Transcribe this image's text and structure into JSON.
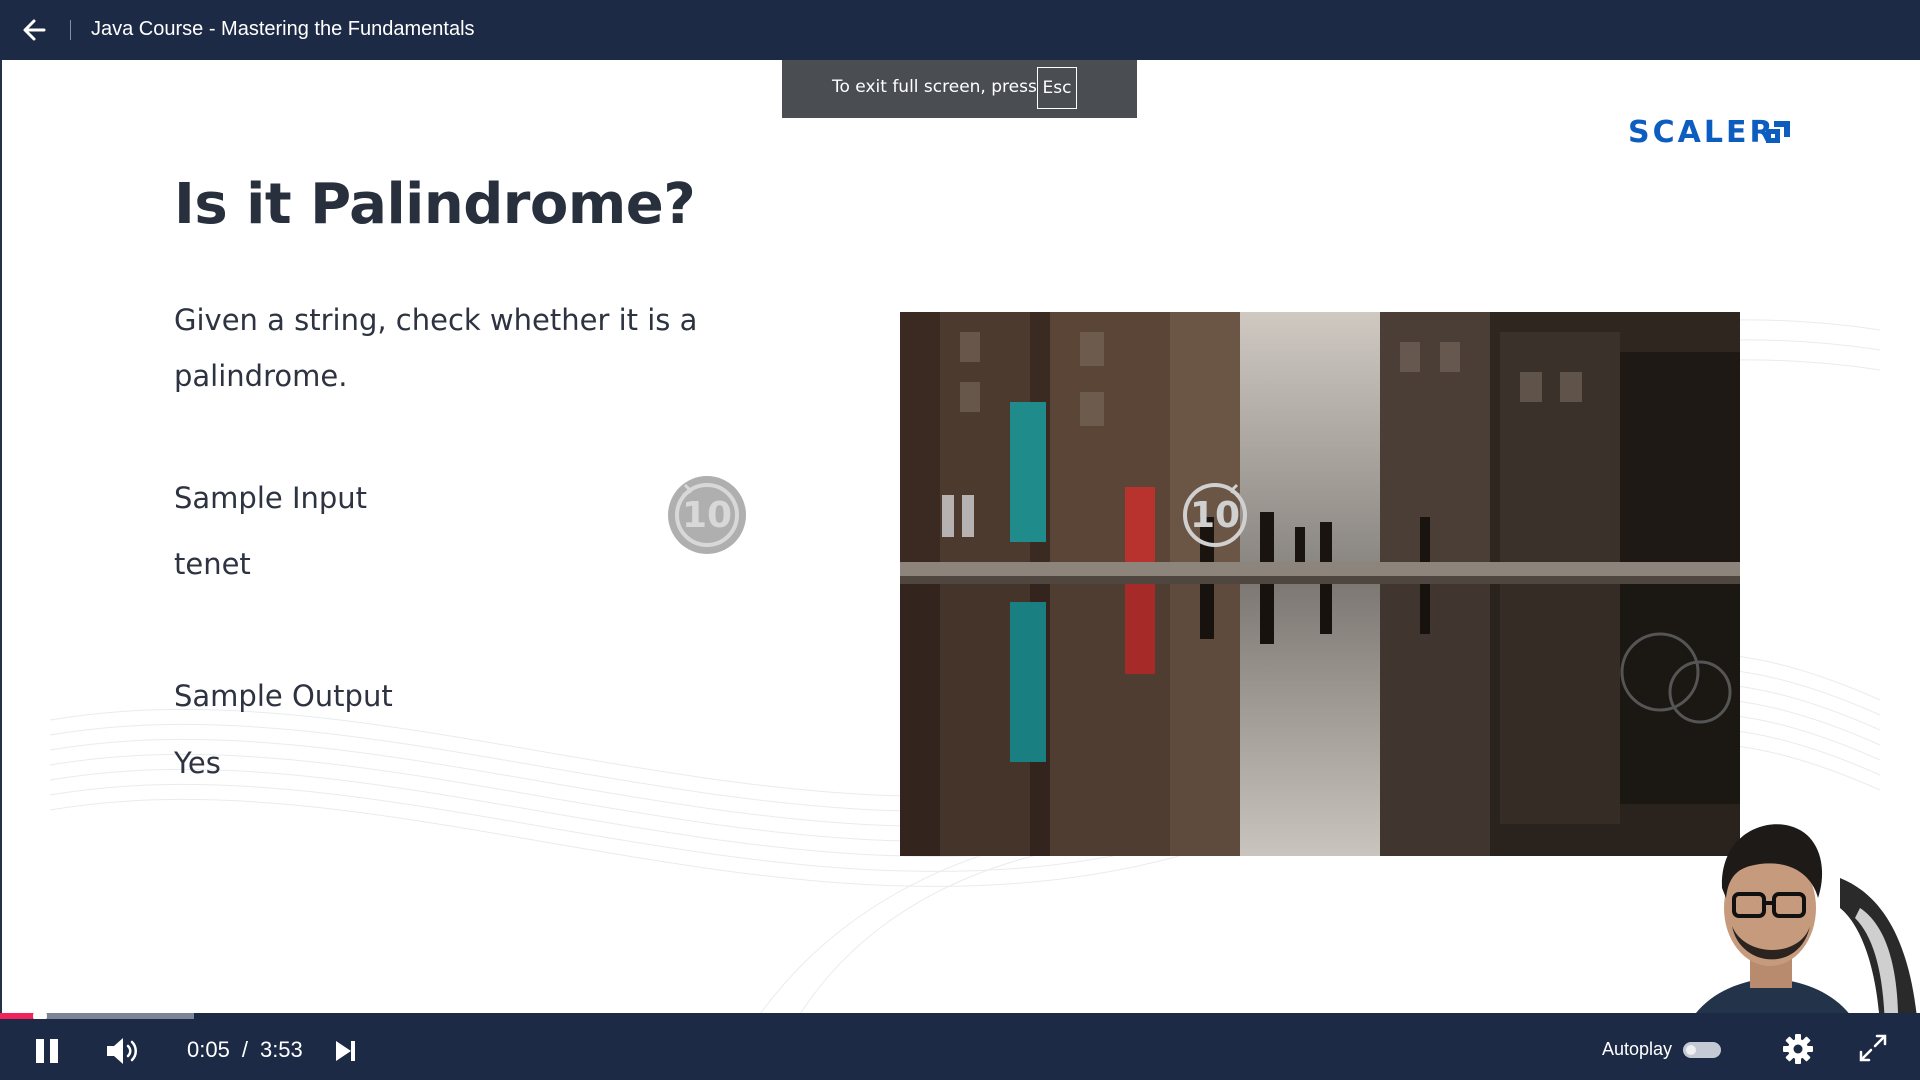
{
  "header": {
    "course_title": "Java Course - Mastering the Fundamentals",
    "back_icon": "arrow-left-icon"
  },
  "fullscreen_toast": {
    "message": "To exit full screen, press",
    "key": "Esc"
  },
  "slide": {
    "logo_text": "SCALER",
    "title": "Is it Palindrome?",
    "description": "Given a string, check whether it is a palindrome.",
    "sample_input_label": "Sample Input",
    "sample_input_value": "tenet",
    "sample_output_label": "Sample Output",
    "sample_output_value": "Yes"
  },
  "overlay": {
    "seek_back_seconds": "10",
    "seek_forward_seconds": "10"
  },
  "player": {
    "current_time": "0:05",
    "time_separator": "/",
    "duration": "3:53",
    "progress_fraction": 0.021,
    "buffered_fraction": 0.101,
    "autoplay_label": "Autoplay",
    "autoplay_on": false,
    "is_playing": true
  },
  "colors": {
    "chrome_bg": "#1c2a45",
    "progress_played": "#f0245a",
    "scaler_blue": "#0d5cbf"
  }
}
